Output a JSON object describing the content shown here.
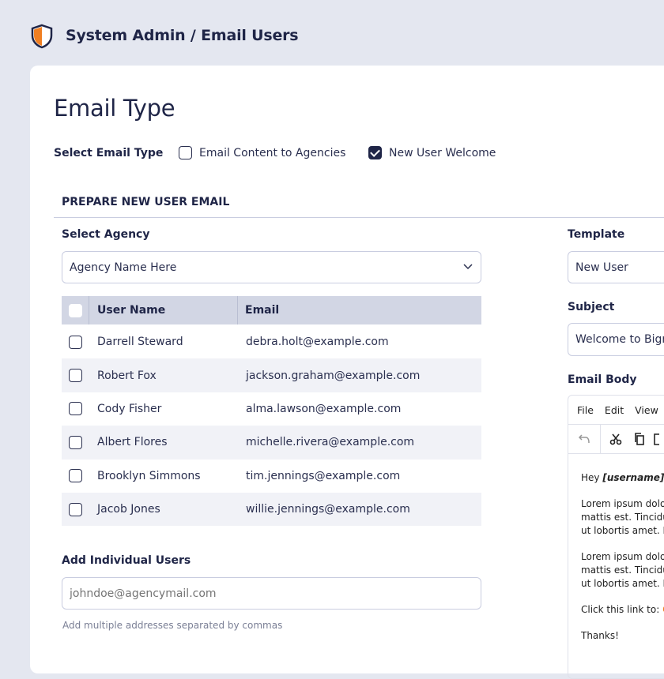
{
  "header": {
    "title": "System Admin / Email Users",
    "icon": "shield-icon"
  },
  "page_title": "Email Type",
  "email_type": {
    "label": "Select Email Type",
    "options": [
      {
        "label": "Email Content to Agencies",
        "checked": false
      },
      {
        "label": "New User Welcome",
        "checked": true
      }
    ]
  },
  "section_title": "PREPARE NEW USER EMAIL",
  "agency": {
    "label": "Select Agency",
    "value": "Agency Name Here"
  },
  "table": {
    "headers": [
      "User Name",
      "Email"
    ],
    "rows": [
      {
        "name": "Darrell Steward",
        "email": "debra.holt@example.com"
      },
      {
        "name": "Robert Fox",
        "email": "jackson.graham@example.com"
      },
      {
        "name": "Cody Fisher",
        "email": "alma.lawson@example.com"
      },
      {
        "name": "Albert Flores",
        "email": "michelle.rivera@example.com"
      },
      {
        "name": "Brooklyn Simmons",
        "email": "tim.jennings@example.com"
      },
      {
        "name": "Jacob Jones",
        "email": "willie.jennings@example.com"
      }
    ]
  },
  "individual": {
    "label": "Add Individual Users",
    "placeholder": "johndoe@agencymail.com",
    "hint": "Add multiple addresses separated by commas"
  },
  "template": {
    "label": "Template",
    "value": "New User"
  },
  "subject": {
    "label": "Subject",
    "value": "Welcome to Bign"
  },
  "email_body": {
    "label": "Email Body",
    "menu": [
      "File",
      "Edit",
      "View"
    ],
    "greeting_prefix": "Hey ",
    "greeting_name": "[username],",
    "para1": [
      "Lorem ipsum dolo",
      "mattis est. Tincidu",
      "ut lobortis amet. N"
    ],
    "para2": [
      "Lorem ipsum dolo",
      "mattis est. Tincidu",
      "ut lobortis amet. N"
    ],
    "link_line": "Click this link to: ",
    "link_text": "C",
    "signoff": "Thanks!"
  },
  "colors": {
    "accent": "#f07f22",
    "navy": "#1f2547"
  }
}
